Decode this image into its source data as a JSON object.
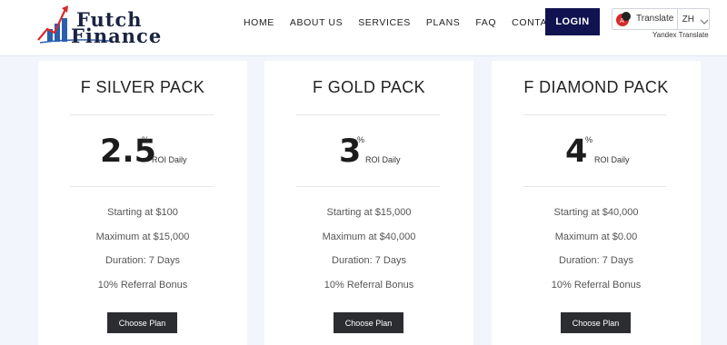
{
  "brand": {
    "line1": "Futch",
    "line2": "Finance",
    "colors": {
      "navy": "#1a2340",
      "accent_red": "#d62b2b",
      "bar_blue": "#2a5fae"
    }
  },
  "nav": {
    "items": [
      "HOME",
      "ABOUT US",
      "SERVICES",
      "PLANS",
      "FAQ",
      "CONTACT"
    ],
    "login_label": "LOGIN"
  },
  "translate": {
    "label": "Translate",
    "language": "ZH",
    "provider": "Yandex Translate",
    "icon": "translate-icon"
  },
  "plans": [
    {
      "title": "F SILVER PACK",
      "roi_value": "2.5",
      "roi_unit": "%",
      "roi_label": "ROI Daily",
      "features": [
        "Starting at $100",
        "Maximum at $15,000",
        "Duration: 7 Days",
        "10% Referral Bonus"
      ],
      "button_label": "Choose Plan"
    },
    {
      "title": "F GOLD PACK",
      "roi_value": "3",
      "roi_unit": "%",
      "roi_label": "ROI Daily",
      "features": [
        "Starting at $15,000",
        "Maximum at $40,000",
        "Duration: 7 Days",
        "10% Referral Bonus"
      ],
      "button_label": "Choose Plan"
    },
    {
      "title": "F DIAMOND PACK",
      "roi_value": "4",
      "roi_unit": "%",
      "roi_label": "ROI Daily",
      "features": [
        "Starting at $40,000",
        "Maximum at $0.00",
        "Duration: 7 Days",
        "10% Referral Bonus"
      ],
      "button_label": "Choose Plan"
    }
  ],
  "theme": {
    "login_bg": "#10134f",
    "button_bg": "#2b2d31",
    "page_bg": "#f2f5fb"
  }
}
